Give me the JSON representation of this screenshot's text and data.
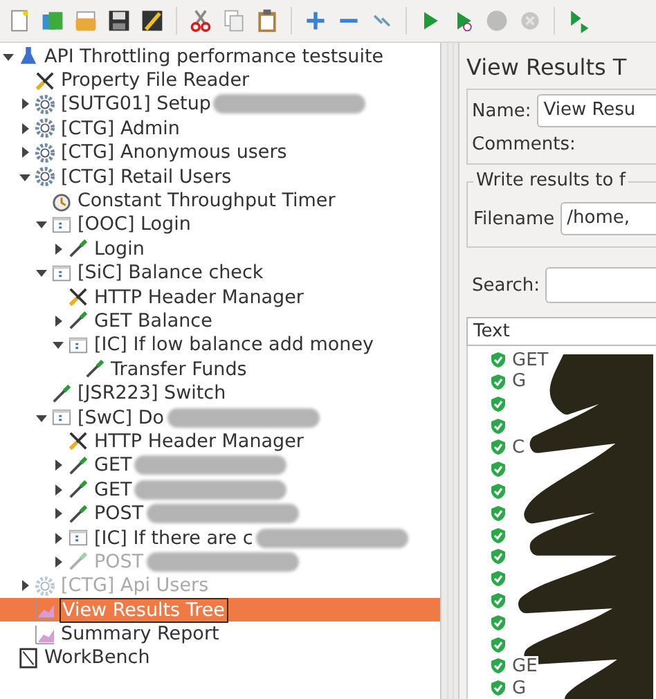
{
  "toolbar": [
    {
      "kind": "new",
      "disabled": false
    },
    {
      "kind": "templates",
      "disabled": false
    },
    {
      "kind": "open",
      "disabled": false
    },
    {
      "kind": "save",
      "disabled": false
    },
    {
      "kind": "save-as",
      "disabled": false
    },
    {
      "kind": "sep"
    },
    {
      "kind": "cut",
      "disabled": false
    },
    {
      "kind": "copy",
      "disabled": false
    },
    {
      "kind": "paste",
      "disabled": false
    },
    {
      "kind": "sep"
    },
    {
      "kind": "expand",
      "disabled": false
    },
    {
      "kind": "collapse",
      "disabled": false
    },
    {
      "kind": "toggle",
      "disabled": false
    },
    {
      "kind": "sep"
    },
    {
      "kind": "start",
      "disabled": false
    },
    {
      "kind": "start-no-pause",
      "disabled": false
    },
    {
      "kind": "stop",
      "disabled": true
    },
    {
      "kind": "shutdown",
      "disabled": true
    },
    {
      "kind": "sep"
    },
    {
      "kind": "remote",
      "disabled": false
    }
  ],
  "tree": [
    {
      "label": "API Throttling performance testsuite",
      "kind": "testplan",
      "expanded": true,
      "selected": false,
      "disabled": false,
      "children": [
        {
          "label": "Property File Reader",
          "kind": "config",
          "selected": false,
          "disabled": false
        },
        {
          "label": "[SUTG01] Setup",
          "kind": "threadgroup",
          "expanded": false,
          "selected": false,
          "disabled": false,
          "redacted": true
        },
        {
          "label": "[CTG] Admin",
          "kind": "threadgroup",
          "expanded": false,
          "selected": false,
          "disabled": false
        },
        {
          "label": "[CTG] Anonymous users",
          "kind": "threadgroup",
          "expanded": false,
          "selected": false,
          "disabled": false
        },
        {
          "label": "[CTG] Retail Users",
          "kind": "threadgroup",
          "expanded": true,
          "selected": false,
          "disabled": false,
          "children": [
            {
              "label": "Constant Throughput Timer",
              "kind": "timer",
              "selected": false,
              "disabled": false
            },
            {
              "label": "[OOC] Login",
              "kind": "controller",
              "expanded": true,
              "selected": false,
              "disabled": false,
              "children": [
                {
                  "label": "Login",
                  "kind": "sampler",
                  "expanded": false,
                  "selected": false,
                  "disabled": false
                }
              ]
            },
            {
              "label": "[SiC] Balance check",
              "kind": "controller",
              "expanded": true,
              "selected": false,
              "disabled": false,
              "children": [
                {
                  "label": "HTTP Header Manager",
                  "kind": "config",
                  "selected": false,
                  "disabled": false
                },
                {
                  "label": "GET Balance",
                  "kind": "sampler",
                  "expanded": false,
                  "selected": false,
                  "disabled": false
                },
                {
                  "label": "[IC] If low balance add money",
                  "kind": "controller",
                  "expanded": true,
                  "selected": false,
                  "disabled": false,
                  "children": [
                    {
                      "label": "Transfer Funds",
                      "kind": "sampler",
                      "selected": false,
                      "disabled": false
                    }
                  ]
                }
              ]
            },
            {
              "label": "[JSR223] Switch",
              "kind": "sampler",
              "selected": false,
              "disabled": false
            },
            {
              "label": "[SwC] Do",
              "kind": "controller",
              "expanded": true,
              "selected": false,
              "disabled": false,
              "redacted": true,
              "children": [
                {
                  "label": "HTTP Header Manager",
                  "kind": "config",
                  "selected": false,
                  "disabled": false
                },
                {
                  "label": "GET",
                  "kind": "sampler",
                  "expanded": false,
                  "selected": false,
                  "disabled": false,
                  "redacted": true
                },
                {
                  "label": "GET",
                  "kind": "sampler",
                  "expanded": false,
                  "selected": false,
                  "disabled": false,
                  "redacted": true
                },
                {
                  "label": "POST",
                  "kind": "sampler",
                  "expanded": false,
                  "selected": false,
                  "disabled": false,
                  "redacted": true
                },
                {
                  "label": "[IC] If there are c",
                  "kind": "controller",
                  "expanded": false,
                  "selected": false,
                  "disabled": false,
                  "redacted": true
                },
                {
                  "label": "POST",
                  "kind": "sampler",
                  "expanded": false,
                  "selected": false,
                  "disabled": true,
                  "redacted": true
                }
              ]
            }
          ]
        },
        {
          "label": "[CTG] Api Users",
          "kind": "threadgroup",
          "expanded": false,
          "selected": false,
          "disabled": true
        },
        {
          "label": "View Results Tree",
          "kind": "listener",
          "selected": true,
          "disabled": false
        },
        {
          "label": "Summary Report",
          "kind": "listener",
          "selected": false,
          "disabled": false
        }
      ]
    },
    {
      "label": "WorkBench",
      "kind": "workbench",
      "selected": false,
      "disabled": false
    }
  ],
  "panel": {
    "title": "View Results T",
    "name_label": "Name:",
    "name_value": "View Resu",
    "comments_label": "Comments:",
    "file_group": "Write results to f",
    "filename_label": "Filename",
    "filename_value": "/home,",
    "search_label": "Search:",
    "renderer": "Text"
  },
  "results": [
    {
      "text": "GET",
      "passed": true
    },
    {
      "text": "G",
      "passed": true
    },
    {
      "passed": true
    },
    {
      "passed": true
    },
    {
      "text": "C",
      "passed": true
    },
    {
      "passed": true
    },
    {
      "passed": true
    },
    {
      "passed": true
    },
    {
      "passed": true
    },
    {
      "passed": true
    },
    {
      "passed": true
    },
    {
      "passed": true
    },
    {
      "passed": true
    },
    {
      "passed": true
    },
    {
      "text": "GE",
      "passed": true
    },
    {
      "text": "G",
      "passed": true
    }
  ]
}
